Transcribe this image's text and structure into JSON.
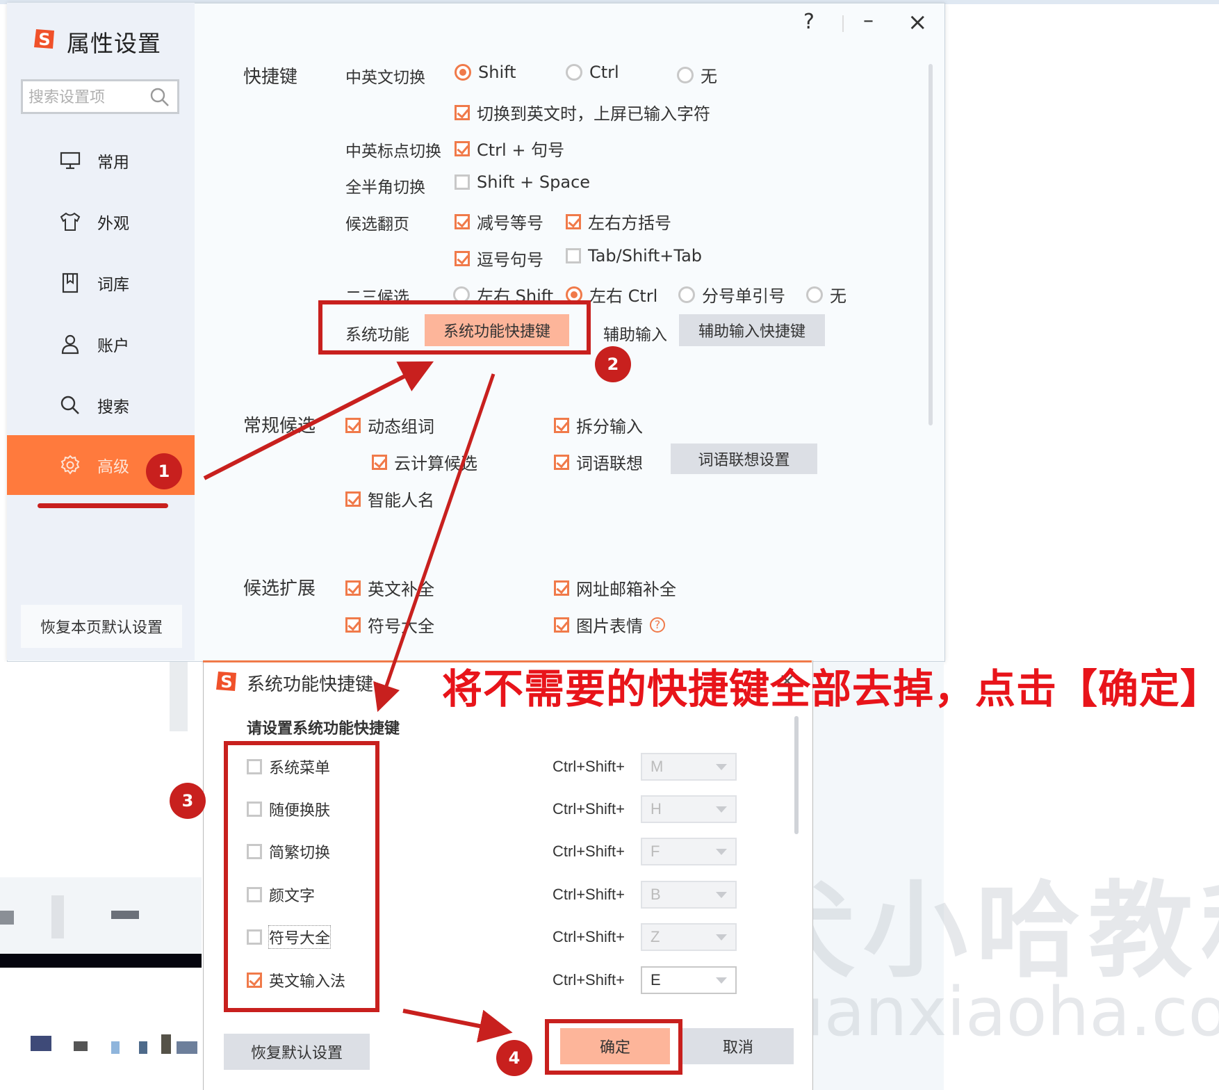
{
  "window": {
    "title": "属性设置",
    "controls": {
      "help": "?",
      "minimize": "–",
      "close": "×"
    },
    "search": {
      "placeholder": "搜索设置项"
    },
    "sidebar": {
      "items": [
        {
          "label": "常用",
          "icon": "monitor-icon"
        },
        {
          "label": "外观",
          "icon": "shirt-icon"
        },
        {
          "label": "词库",
          "icon": "book-icon"
        },
        {
          "label": "账户",
          "icon": "user-icon"
        },
        {
          "label": "搜索",
          "icon": "search-icon"
        },
        {
          "label": "高级",
          "icon": "gear-icon",
          "active": true
        }
      ],
      "restore_label": "恢复本页默认设置"
    },
    "shortcuts": {
      "section_title": "快捷键",
      "cn_en_switch": {
        "label": "中英文切换",
        "options": [
          {
            "label": "Shift",
            "selected": true
          },
          {
            "label": "Ctrl",
            "selected": false
          },
          {
            "label": "无",
            "selected": false
          }
        ],
        "commit_on_switch": {
          "label": "切换到英文时，上屏已输入字符",
          "checked": true
        }
      },
      "punct_switch": {
        "label": "中英标点切换",
        "option": {
          "label": "Ctrl + 句号",
          "checked": true
        }
      },
      "width_switch": {
        "label": "全半角切换",
        "option": {
          "label": "Shift + Space",
          "checked": false
        }
      },
      "page_turn": {
        "label": "候选翻页",
        "options": [
          {
            "label": "减号等号",
            "checked": true
          },
          {
            "label": "左右方括号",
            "checked": true
          },
          {
            "label": "逗号句号",
            "checked": true
          },
          {
            "label": "Tab/Shift+Tab",
            "checked": false
          }
        ]
      },
      "second_third": {
        "label": "二三候选",
        "options": [
          {
            "label": "左右 Shift",
            "selected": false
          },
          {
            "label": "左右 Ctrl",
            "selected": true
          },
          {
            "label": "分号单引号",
            "selected": false
          },
          {
            "label": "无",
            "selected": false
          }
        ]
      },
      "system": {
        "label": "系统功能",
        "button": "系统功能快捷键"
      },
      "assist": {
        "label": "辅助输入",
        "button": "辅助输入快捷键"
      }
    },
    "candidates": {
      "section_title": "常规候选",
      "options": [
        {
          "label": "动态组词",
          "checked": true
        },
        {
          "label": "拆分输入",
          "checked": true
        },
        {
          "label": "云计算候选",
          "checked": true
        },
        {
          "label": "词语联想",
          "checked": true
        },
        {
          "label": "智能人名",
          "checked": true
        }
      ],
      "assoc_button": "词语联想设置"
    },
    "expansion": {
      "section_title": "候选扩展",
      "options": [
        {
          "label": "英文补全",
          "checked": true
        },
        {
          "label": "网址邮箱补全",
          "checked": true
        },
        {
          "label": "符号大全",
          "checked": true
        },
        {
          "label": "图片表情",
          "checked": true
        }
      ]
    }
  },
  "dialog": {
    "title": "系统功能快捷键",
    "subtitle": "请设置系统功能快捷键",
    "prefix": "Ctrl+Shift+",
    "rows": [
      {
        "label": "系统菜单",
        "checked": false,
        "key": "M"
      },
      {
        "label": "随便换肤",
        "checked": false,
        "key": "H"
      },
      {
        "label": "简繁切换",
        "checked": false,
        "key": "F"
      },
      {
        "label": "颜文字",
        "checked": false,
        "key": "B"
      },
      {
        "label": "符号大全",
        "checked": false,
        "key": "Z"
      },
      {
        "label": "英文输入法",
        "checked": true,
        "key": "E"
      }
    ],
    "restore_label": "恢复默认设置",
    "ok_label": "确定",
    "cancel_label": "取消"
  },
  "annotations": {
    "badges": [
      "1",
      "2",
      "3",
      "4"
    ],
    "instruction": "将不需要的快捷键全部去掉，点击【确定】",
    "annotation_color": "#c8201e"
  },
  "watermark": {
    "cn": "犬小哈教程",
    "en": "quanxiaoha.com"
  },
  "colors": {
    "accent": "#ff7a3d",
    "check": "#f07a4a",
    "peach_button": "#fdb59a"
  }
}
